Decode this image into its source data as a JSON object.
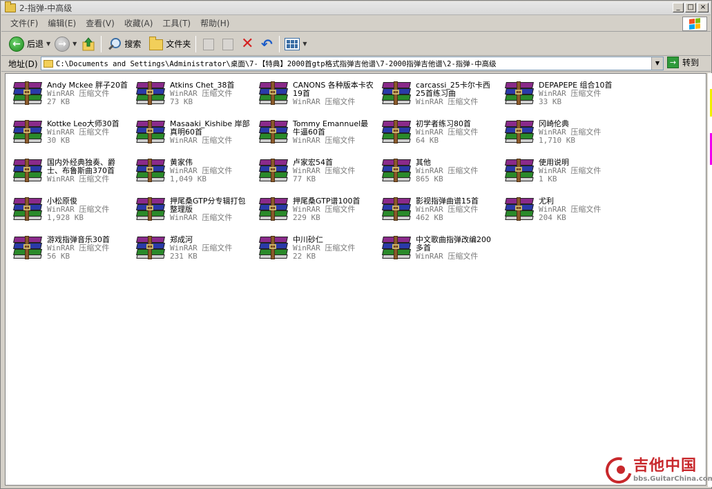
{
  "window": {
    "title": "2-指弹-中高级",
    "minimize": "_",
    "maximize": "□",
    "close": "×"
  },
  "menu": [
    "文件(F)",
    "编辑(E)",
    "查看(V)",
    "收藏(A)",
    "工具(T)",
    "帮助(H)"
  ],
  "toolbar": {
    "back_label": "后退",
    "search_label": "搜索",
    "folders_label": "文件夹"
  },
  "address": {
    "label": "地址(D)",
    "path": "C:\\Documents and Settings\\Administrator\\桌面\\7-【特典】2000首gtp格式指弹吉他谱\\7-2000指弹吉他谱\\2-指弹-中高级",
    "go_label": "转到"
  },
  "files": [
    {
      "name": "Andy Mckee 胖子20首",
      "type": "WinRAR 压缩文件",
      "size": "27 KB"
    },
    {
      "name": "Atkins Chet_38首",
      "type": "WinRAR 压缩文件",
      "size": "73 KB"
    },
    {
      "name": "CANONS 各种版本卡农19首",
      "type": "WinRAR 压缩文件",
      "size": ""
    },
    {
      "name": "carcassi_25卡尔卡西25首练习曲",
      "type": "WinRAR 压缩文件",
      "size": ""
    },
    {
      "name": "DEPAPEPE 组合10首",
      "type": "WinRAR 压缩文件",
      "size": "33 KB"
    },
    {
      "name": "Kottke Leo大师30首",
      "type": "WinRAR 压缩文件",
      "size": "30 KB"
    },
    {
      "name": "Masaaki_Kishibe 岸部真明60首",
      "type": "WinRAR 压缩文件",
      "size": ""
    },
    {
      "name": "Tommy Emannuel最牛逼60首",
      "type": "WinRAR 压缩文件",
      "size": ""
    },
    {
      "name": "初学者练习80首",
      "type": "WinRAR 压缩文件",
      "size": "64 KB"
    },
    {
      "name": "冈崎伦典",
      "type": "WinRAR 压缩文件",
      "size": "1,710 KB"
    },
    {
      "name": "国内外经典独奏、爵士、布鲁斯曲370首",
      "type": "WinRAR 压缩文件",
      "size": ""
    },
    {
      "name": "黄家伟",
      "type": "WinRAR 压缩文件",
      "size": "1,049 KB"
    },
    {
      "name": "卢家宏54首",
      "type": "WinRAR 压缩文件",
      "size": "77 KB"
    },
    {
      "name": "其他",
      "type": "WinRAR 压缩文件",
      "size": "865 KB"
    },
    {
      "name": "使用说明",
      "type": "WinRAR 压缩文件",
      "size": "1 KB"
    },
    {
      "name": "小松原俊",
      "type": "WinRAR 压缩文件",
      "size": "1,928 KB"
    },
    {
      "name": "押尾桑GTP分专辑打包整理版",
      "type": "WinRAR 压缩文件",
      "size": ""
    },
    {
      "name": "押尾桑GTP谱100首",
      "type": "WinRAR 压缩文件",
      "size": "229 KB"
    },
    {
      "name": "影视指弹曲谱15首",
      "type": "WinRAR 压缩文件",
      "size": "462 KB"
    },
    {
      "name": "尤利",
      "type": "WinRAR 压缩文件",
      "size": "204 KB"
    },
    {
      "name": "游戏指弹音乐30首",
      "type": "WinRAR 压缩文件",
      "size": "56 KB"
    },
    {
      "name": "郑成河",
      "type": "WinRAR 压缩文件",
      "size": "231 KB"
    },
    {
      "name": "中川砂仁",
      "type": "WinRAR 压缩文件",
      "size": "22 KB"
    },
    {
      "name": "中文歌曲指弹改编200多首",
      "type": "WinRAR 压缩文件",
      "size": ""
    }
  ],
  "watermark": {
    "title": "吉他中国",
    "url": "bbs.GuitarChina.com"
  },
  "icons": {
    "file_icon": "winrar-archive-icon",
    "back": "back-arrow-icon",
    "forward": "forward-arrow-icon",
    "up": "folder-up-icon",
    "search": "search-icon",
    "folders": "folders-icon",
    "delete": "delete-icon",
    "undo": "undo-icon",
    "views": "views-icon",
    "go": "go-arrow-icon"
  }
}
